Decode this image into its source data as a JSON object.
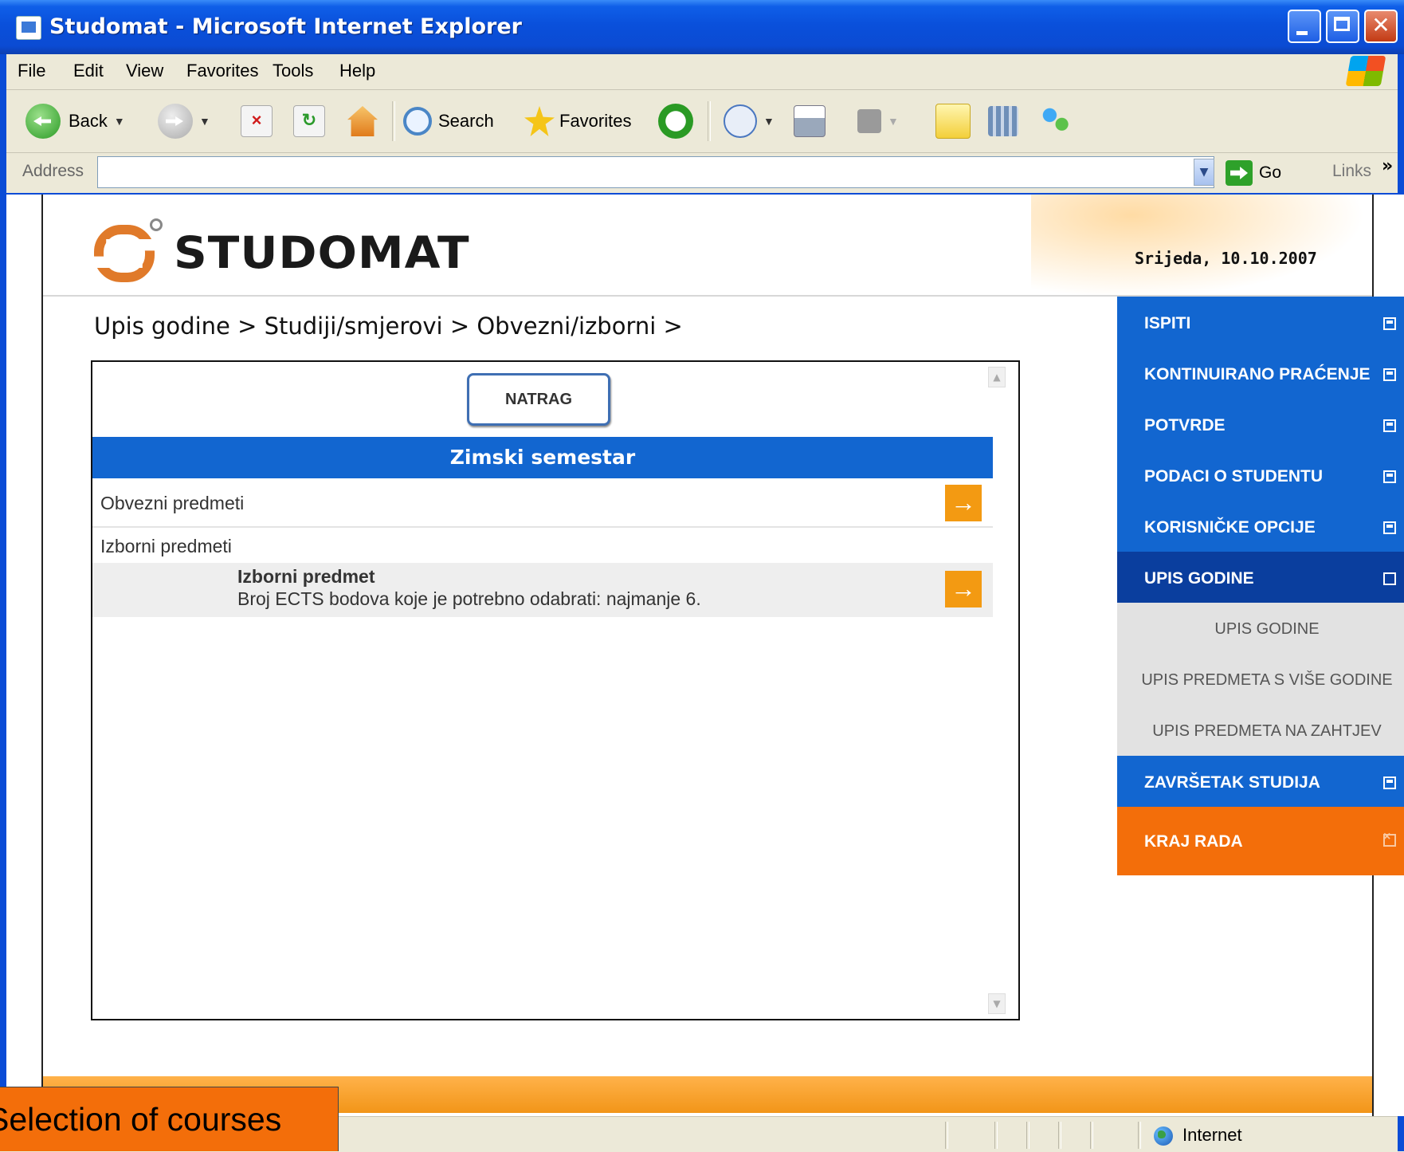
{
  "window": {
    "title": "Studomat - Microsoft Internet Explorer",
    "controls": [
      "minimize-icon",
      "maximize-icon",
      "close-icon"
    ]
  },
  "menubar": [
    "File",
    "Edit",
    "View",
    "Favorites",
    "Tools",
    "Help"
  ],
  "toolbar": {
    "back_label": "Back",
    "search_label": "Search",
    "favorites_label": "Favorites"
  },
  "addressbar": {
    "label": "Address",
    "value": "",
    "go_label": "Go",
    "links_label": "Links",
    "links_chevron": "»"
  },
  "page": {
    "logo_text": "STUDOMAT",
    "date": "Srijeda, 10.10.2007",
    "breadcrumb": "Upis godine > Studiji/smjerovi > Obvezni/izborni >",
    "back_button": "NATRAG",
    "semester_header": "Zimski semestar",
    "rows": {
      "obvezni": "Obvezni predmeti",
      "izborni": "Izborni predmeti",
      "predmet_title": "Izborni predmet",
      "predmet_desc": "Broj ECTS bodova koje je potrebno odabrati: najmanje 6."
    }
  },
  "sidebar": {
    "items": [
      {
        "label": "ISPITI",
        "style": "blue"
      },
      {
        "label": "KONTINUIRANO PRAĆENJE",
        "style": "blue"
      },
      {
        "label": "POTVRDE",
        "style": "blue"
      },
      {
        "label": "PODACI O STUDENTU",
        "style": "blue"
      },
      {
        "label": "KORISNIČKE OPCIJE",
        "style": "blue"
      },
      {
        "label": "UPIS GODINE",
        "style": "active"
      },
      {
        "label": "UPIS GODINE",
        "style": "sub"
      },
      {
        "label": "UPIS PREDMETA S VIŠE GODINE",
        "style": "sub"
      },
      {
        "label": "UPIS PREDMETA NA ZAHTJEV",
        "style": "sub"
      },
      {
        "label": "ZAVRŠETAK STUDIJA",
        "style": "blue"
      },
      {
        "label": "KRAJ RADA",
        "style": "orange"
      }
    ]
  },
  "statusbar": {
    "zone": "Internet"
  },
  "caption": "Selection of courses",
  "colors": {
    "nav_blue": "#1266d0",
    "nav_active": "#0a3e9e",
    "accent_orange": "#f36e0a",
    "arrow_orange": "#f39a12"
  }
}
